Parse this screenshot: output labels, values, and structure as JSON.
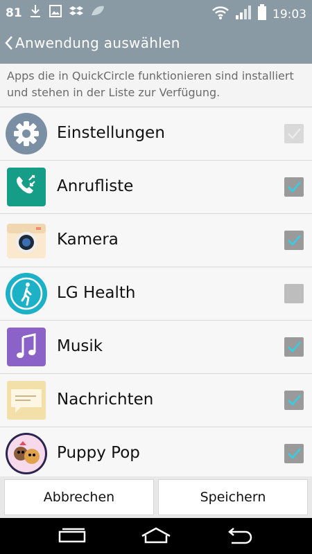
{
  "status": {
    "battery_level": "81",
    "time": "19:03"
  },
  "appbar": {
    "title": "Anwendung auswählen"
  },
  "description": "Apps die in QuickCircle funktionieren sind installiert und stehen in der Liste zur Verfügung.",
  "apps": [
    {
      "label": "Einstellungen",
      "icon": "settings-icon",
      "checked": true,
      "disabled": true
    },
    {
      "label": "Anrufliste",
      "icon": "call-log-icon",
      "checked": true
    },
    {
      "label": "Kamera",
      "icon": "camera-icon",
      "checked": true
    },
    {
      "label": "LG Health",
      "icon": "lg-health-icon",
      "checked": false
    },
    {
      "label": "Musik",
      "icon": "music-icon",
      "checked": true
    },
    {
      "label": "Nachrichten",
      "icon": "messages-icon",
      "checked": true
    },
    {
      "label": "Puppy Pop",
      "icon": "puppy-pop-icon",
      "checked": true
    }
  ],
  "actions": {
    "cancel": "Abbrechen",
    "save": "Speichern"
  },
  "colors": {
    "accent": "#2fd0e8",
    "header": "#8a9aa5"
  }
}
